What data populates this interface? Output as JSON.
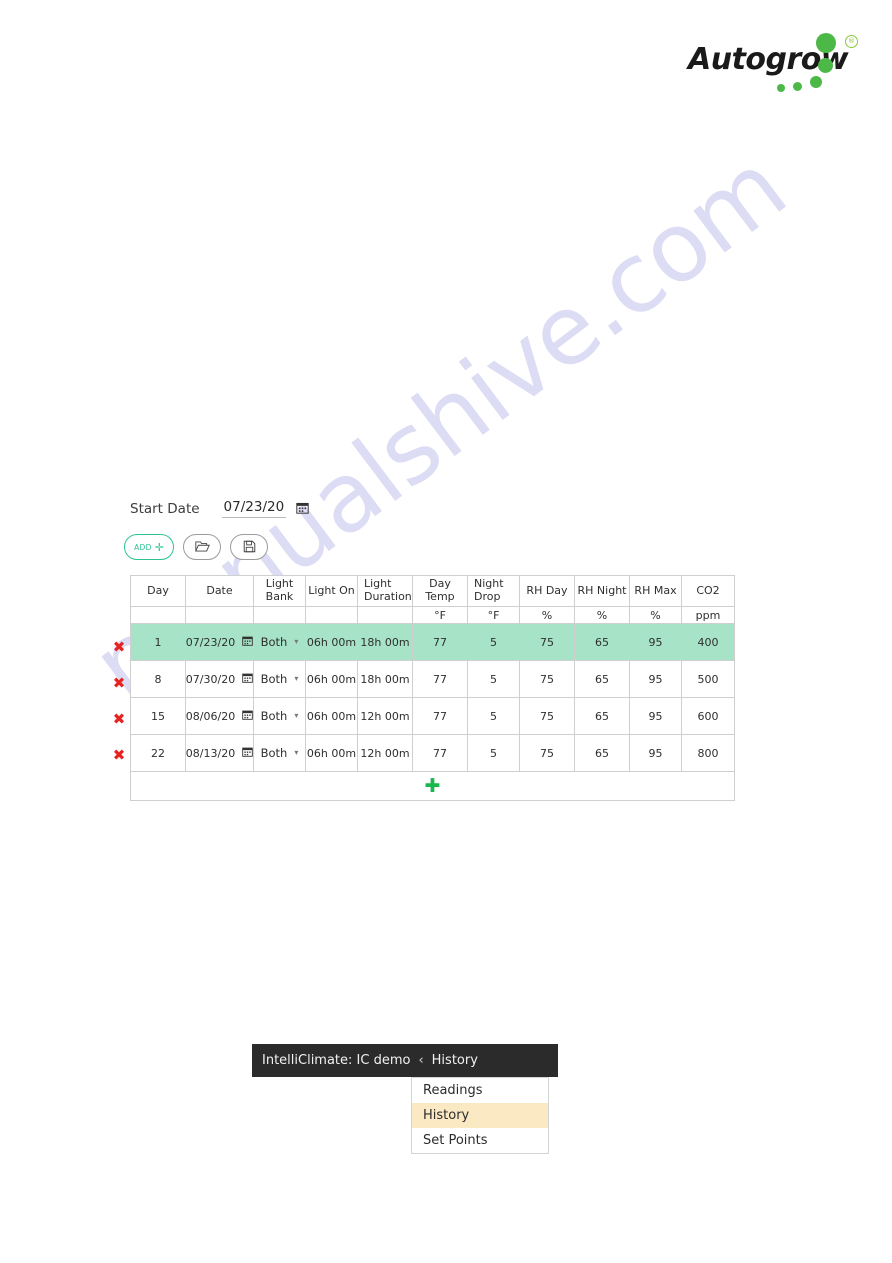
{
  "brand": {
    "name": "Autogrow",
    "registered_mark": "®",
    "accent_green": "#4cb847"
  },
  "form": {
    "start_date_label": "Start Date",
    "start_date_value": "07/23/20",
    "calendar_icon": "calendar-icon"
  },
  "toolbar": {
    "add_label": "ADD",
    "add_plus": "✛",
    "open_icon": "folder-open-icon",
    "save_icon": "save-disk-icon"
  },
  "table": {
    "columns": [
      {
        "label": "Day",
        "unit": ""
      },
      {
        "label": "Date",
        "unit": ""
      },
      {
        "label": "Light Bank",
        "unit": ""
      },
      {
        "label": "Light On",
        "unit": ""
      },
      {
        "label": "Light Duration",
        "unit": ""
      },
      {
        "label": "Day Temp",
        "unit": "°F"
      },
      {
        "label": "Night Drop",
        "unit": "°F"
      },
      {
        "label": "RH Day",
        "unit": "%"
      },
      {
        "label": "RH Night",
        "unit": "%"
      },
      {
        "label": "RH Max",
        "unit": "%"
      },
      {
        "label": "CO2",
        "unit": "ppm"
      }
    ],
    "rows": [
      {
        "day": "1",
        "date": "07/23/20",
        "light_bank": "Both",
        "light_on": "06h 00m",
        "light_duration": "18h 00m",
        "day_temp": "77",
        "night_drop": "5",
        "rh_day": "75",
        "rh_night": "65",
        "rh_max": "95",
        "co2": "400",
        "selected": true
      },
      {
        "day": "8",
        "date": "07/30/20",
        "light_bank": "Both",
        "light_on": "06h 00m",
        "light_duration": "18h 00m",
        "day_temp": "77",
        "night_drop": "5",
        "rh_day": "75",
        "rh_night": "65",
        "rh_max": "95",
        "co2": "500",
        "selected": false
      },
      {
        "day": "15",
        "date": "08/06/20",
        "light_bank": "Both",
        "light_on": "06h 00m",
        "light_duration": "12h 00m",
        "day_temp": "77",
        "night_drop": "5",
        "rh_day": "75",
        "rh_night": "65",
        "rh_max": "95",
        "co2": "600",
        "selected": false
      },
      {
        "day": "22",
        "date": "08/13/20",
        "light_bank": "Both",
        "light_on": "06h 00m",
        "light_duration": "12h 00m",
        "day_temp": "77",
        "night_drop": "5",
        "rh_day": "75",
        "rh_night": "65",
        "rh_max": "95",
        "co2": "800",
        "selected": false
      }
    ],
    "delete_icon": "✖",
    "add_row_icon": "✚",
    "selected_row_color": "#a7e3c6"
  },
  "nav": {
    "title": "IntelliClimate: IC demo",
    "chevron": "‹",
    "current": "History",
    "menu_items": [
      {
        "label": "Readings",
        "active": false
      },
      {
        "label": "History",
        "active": true
      },
      {
        "label": "Set Points",
        "active": false
      }
    ],
    "active_color": "#fbe9c4"
  },
  "watermark": {
    "text": "manualshive.com",
    "color": "#c9c8ef"
  }
}
